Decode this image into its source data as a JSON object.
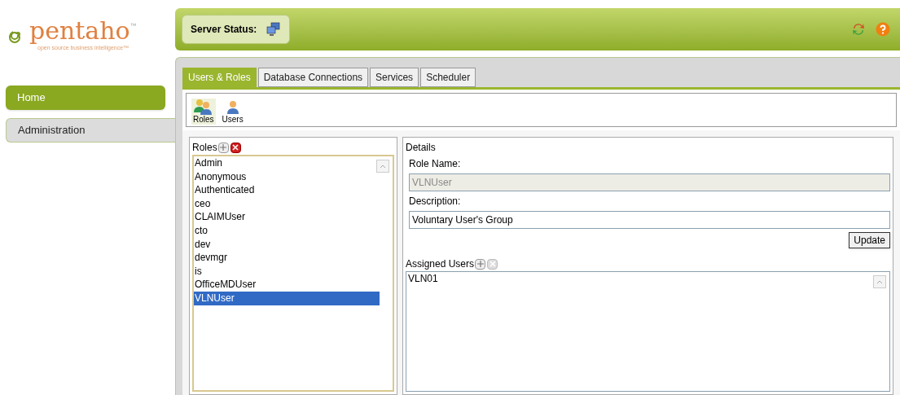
{
  "logo": {
    "name": "pentaho",
    "trademark": "™",
    "tagline": "open source business intelligence™"
  },
  "nav": [
    {
      "label": "Home",
      "selected": false
    },
    {
      "label": "Administration",
      "selected": true
    }
  ],
  "header": {
    "server_status_label": "Server Status:"
  },
  "tabs": [
    {
      "label": "Users & Roles",
      "selected": true
    },
    {
      "label": "Database Connections",
      "selected": false
    },
    {
      "label": "Services",
      "selected": false
    },
    {
      "label": "Scheduler",
      "selected": false
    }
  ],
  "toolbar": [
    {
      "label": "Roles",
      "kind": "roles",
      "selected": true
    },
    {
      "label": "Users",
      "kind": "user",
      "selected": false
    }
  ],
  "roles": {
    "title": "Roles",
    "items": [
      {
        "label": "Admin",
        "selected": false
      },
      {
        "label": "Anonymous",
        "selected": false
      },
      {
        "label": "Authenticated",
        "selected": false
      },
      {
        "label": "ceo",
        "selected": false
      },
      {
        "label": "CLAIMUser",
        "selected": false
      },
      {
        "label": "cto",
        "selected": false
      },
      {
        "label": "dev",
        "selected": false
      },
      {
        "label": "devmgr",
        "selected": false
      },
      {
        "label": "is",
        "selected": false
      },
      {
        "label": "OfficeMDUser",
        "selected": false
      },
      {
        "label": "VLNUser",
        "selected": true
      }
    ]
  },
  "details": {
    "title": "Details",
    "role_name_label": "Role Name:",
    "role_name": "VLNUser",
    "role_name_disabled": true,
    "description_label": "Description:",
    "description": "Voluntary User's Group",
    "update_button": "Update",
    "assigned_users_label": "Assigned Users",
    "remove_disabled": true,
    "assigned_users": [
      "VLN01"
    ]
  }
}
